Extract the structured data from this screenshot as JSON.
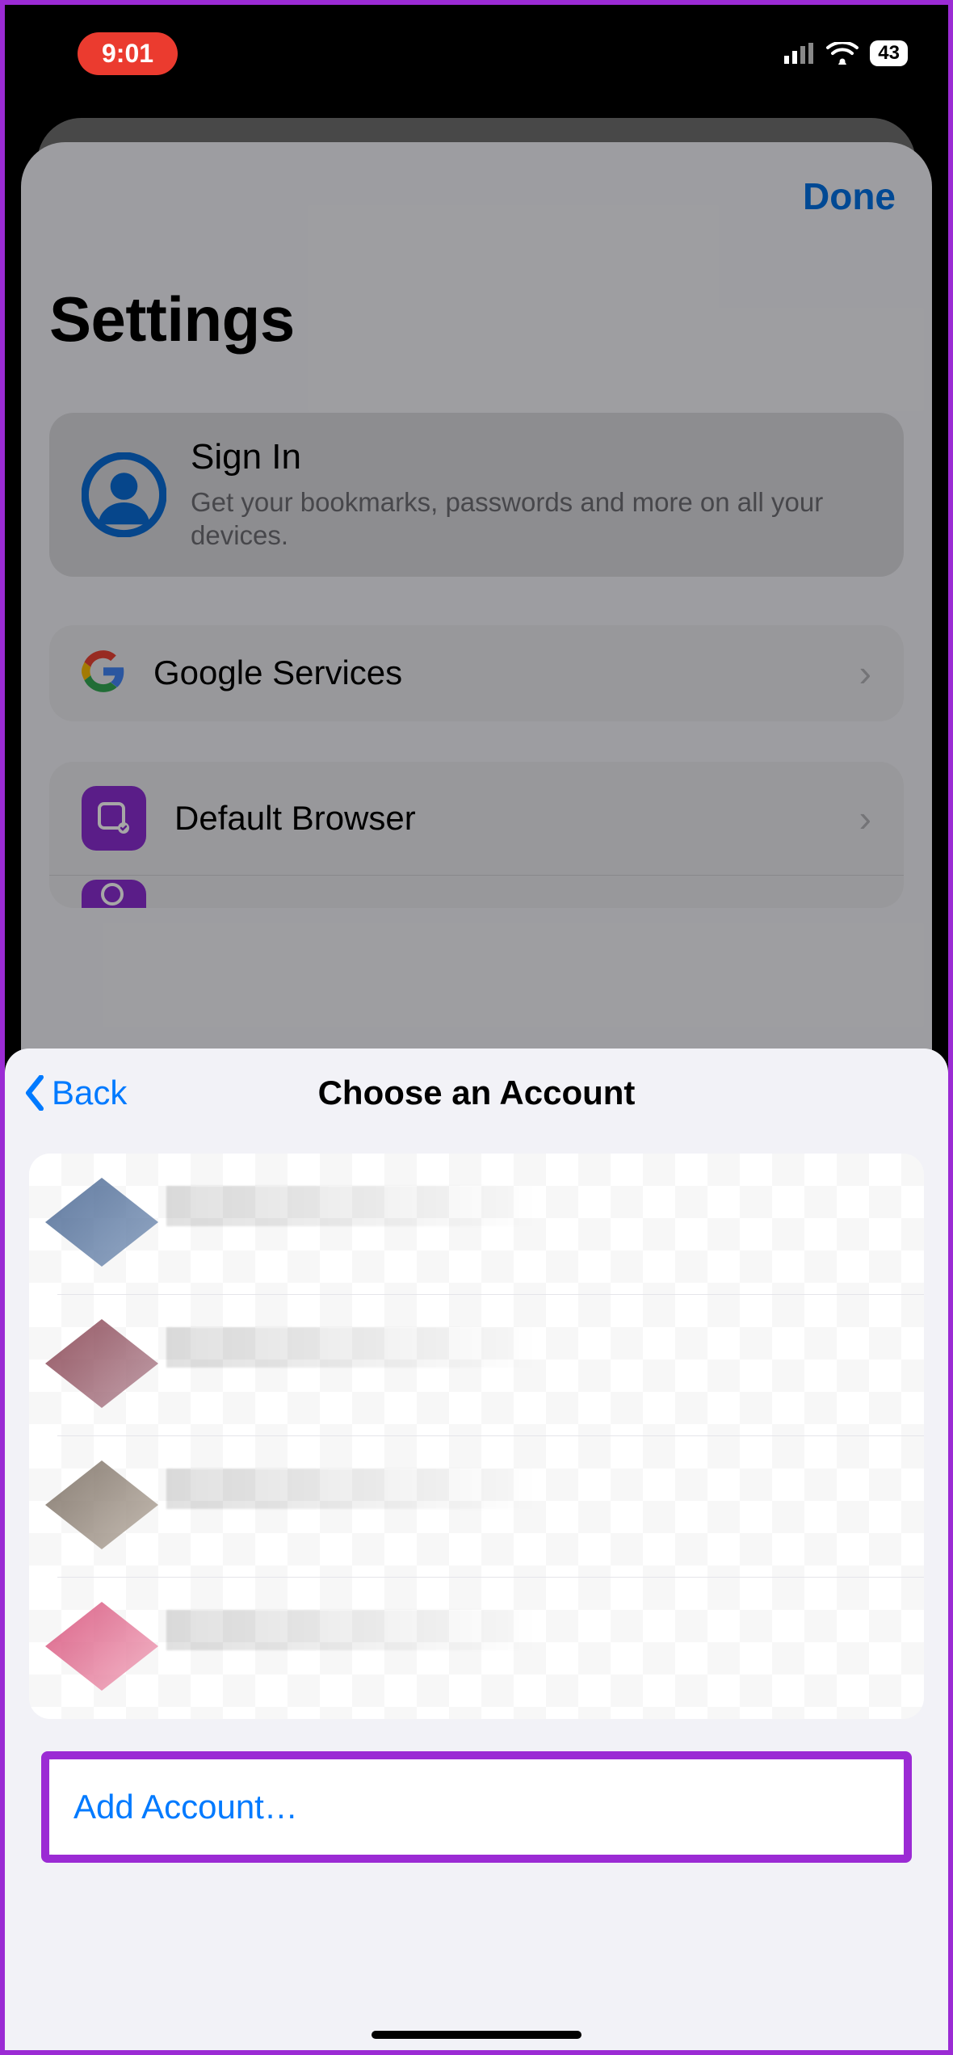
{
  "status": {
    "time": "9:01",
    "battery": "43"
  },
  "sheet": {
    "done": "Done",
    "title": "Settings",
    "signin": {
      "title": "Sign In",
      "subtitle": "Get your bookmarks, passwords and more on all your devices."
    },
    "rows": {
      "google_services": "Google Services",
      "default_browser": "Default Browser"
    }
  },
  "modal": {
    "back": "Back",
    "title": "Choose an Account",
    "add_account": "Add Account…"
  }
}
